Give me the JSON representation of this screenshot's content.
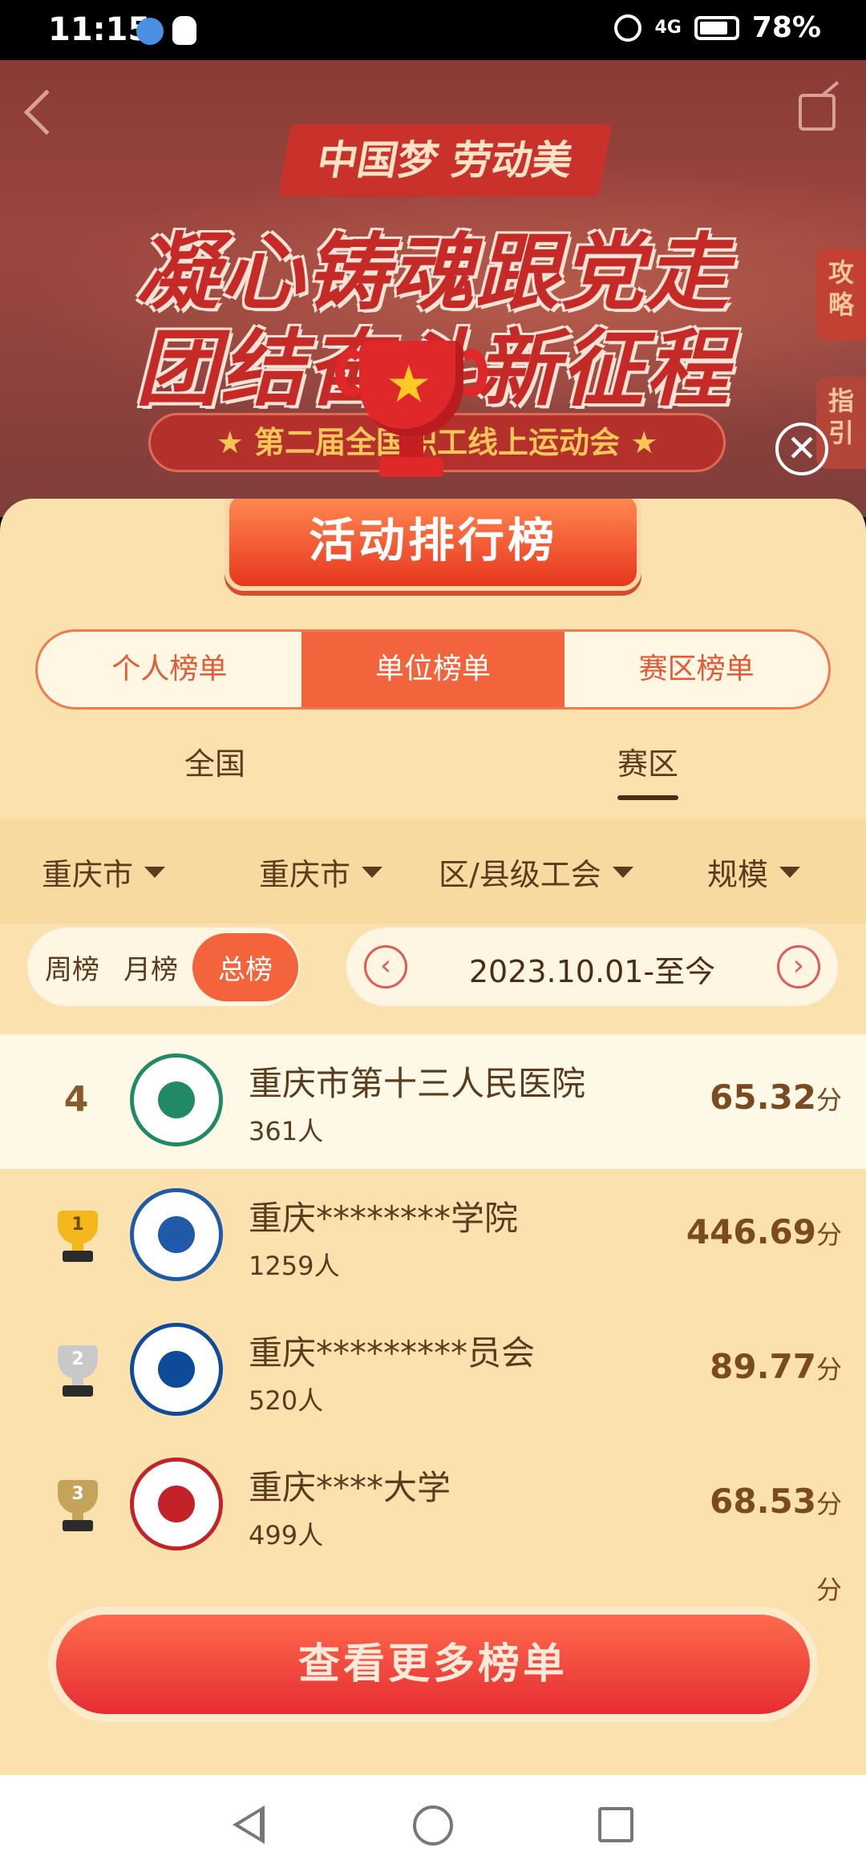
{
  "status_bar": {
    "time": "11:15",
    "network": "4G",
    "battery": "78%"
  },
  "banner": {
    "slogan_top": "中国梦 劳动美",
    "slogan_line1": "凝心铸魂跟党走",
    "slogan_line2": "团结奋斗新征程",
    "subtitle": "★ 第二届全国职工线上运动会 ★",
    "side_tab_1": "攻略",
    "side_tab_2": "指引",
    "close_symbol": "✕"
  },
  "panel": {
    "title": "活动排行榜",
    "segments": [
      {
        "label": "个人榜单",
        "active": false
      },
      {
        "label": "单位榜单",
        "active": true
      },
      {
        "label": "赛区榜单",
        "active": false
      }
    ],
    "scope_tabs": [
      {
        "label": "全国",
        "active": false
      },
      {
        "label": "赛区",
        "active": true
      }
    ],
    "filters": [
      {
        "label": "重庆市"
      },
      {
        "label": "重庆市"
      },
      {
        "label": "区/县级工会"
      },
      {
        "label": "规模"
      }
    ],
    "periods": [
      {
        "label": "周榜",
        "active": false
      },
      {
        "label": "月榜",
        "active": false
      },
      {
        "label": "总榜",
        "active": true
      }
    ],
    "date_range": "2023.10.01-至今",
    "date_prev": "‹",
    "date_next": "›",
    "score_unit": "分",
    "my_row": {
      "rank": "4",
      "name": "重庆市第十三人民医院",
      "count": "361人",
      "score": "65.32",
      "logo": "hospital-logo"
    },
    "rows": [
      {
        "medal": "1",
        "medal_type": "gold",
        "name": "重庆********学院",
        "count": "1259人",
        "score": "446.69",
        "logo": "college-logo"
      },
      {
        "medal": "2",
        "medal_type": "silver",
        "name": "重庆*********员会",
        "count": "520人",
        "score": "89.77",
        "logo": "university-logo"
      },
      {
        "medal": "3",
        "medal_type": "bronze",
        "name": "重庆****大学",
        "count": "499人",
        "score": "68.53",
        "logo": "normal-university-logo"
      }
    ],
    "more_button": "查看更多榜单"
  },
  "colors": {
    "accent": "#f3643c",
    "panel_bg": "#fae1ae",
    "text": "#5a3b1e"
  }
}
